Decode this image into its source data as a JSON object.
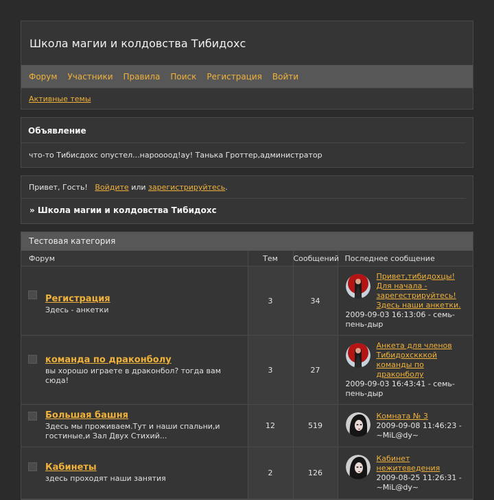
{
  "site": {
    "title": "Школа магии и колдовства Тибидохс"
  },
  "nav": [
    "Форум",
    "Участники",
    "Правила",
    "Поиск",
    "Регистрация",
    "Войти"
  ],
  "subnav": {
    "active_topics": "Активные темы"
  },
  "announcement": {
    "title": "Объявление",
    "text": "что-то Тибисдохс опустел...нароооод!ау! Танька Гроттер,администратор"
  },
  "welcome": {
    "greeting": "Привет, Гость!",
    "login": "Войдите",
    "or": "или",
    "register": "зарегистрируйтесь",
    "end": "."
  },
  "breadcrumb": "» Школа магии и колдовства Тибидохс",
  "category": {
    "name": "Тестовая категория",
    "columns": {
      "forum": "Форум",
      "topics": "Тем",
      "posts": "Сообщений",
      "last_post": "Последнее сообщение"
    },
    "forums": [
      {
        "name": "Регистрация",
        "desc": "Здесь - анкетки",
        "topics": "3",
        "posts": "34",
        "last": {
          "title": "Привет,тибидохцы! Для начала - зарегестрируйтесь! Здесь наши анкетки.",
          "meta": "2009-09-03 16:13:06 - семь-пень-дыр",
          "avatar": "red-girl-avatar"
        }
      },
      {
        "name": "команда по драконболу",
        "desc": "вы хорошо играете в драконбол? тогда вам сюда!",
        "topics": "3",
        "posts": "27",
        "last": {
          "title": "Анкета для членов Тибидохскккой команды по драконболу",
          "meta": "2009-09-03 16:43:41 - семь-пень-дыр",
          "avatar": "red-girl-avatar"
        }
      },
      {
        "name": "Большая башня",
        "desc": "Здесь мы проживаем.Тут и наши спальни,и гостиные,и Зал Двух Стихий...",
        "topics": "12",
        "posts": "519",
        "last": {
          "title": "Комната № 3",
          "meta": "2009-09-08 11:46:23 - ~MiL@dy~",
          "avatar": "dark-girl-avatar"
        }
      },
      {
        "name": "Кабинеты",
        "desc": "здесь проходят наши занятия",
        "topics": "2",
        "posts": "126",
        "last": {
          "title": "Кабинет нежитеведения",
          "meta": "2009-08-25 11:26:31 - ~MiL@dy~",
          "avatar": "dark-girl-avatar"
        }
      }
    ]
  },
  "colors": {
    "accent": "#f0b23a",
    "background": "#2b2b2b",
    "panel": "#353535",
    "bar": "#575757"
  }
}
